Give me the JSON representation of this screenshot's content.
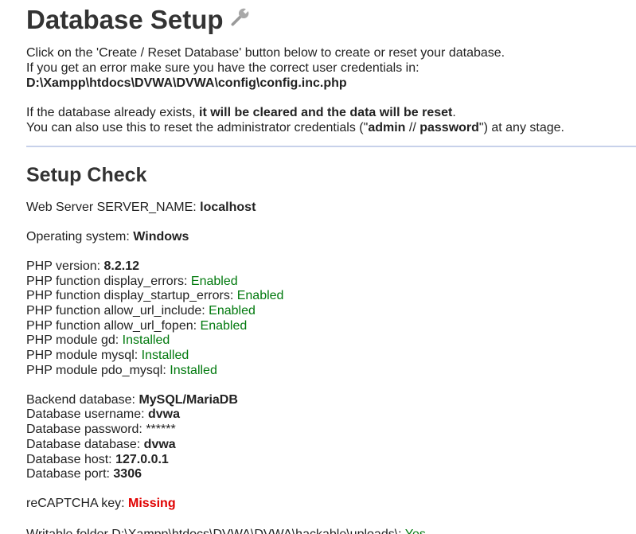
{
  "header": {
    "title": "Database Setup",
    "icon": "wrench-icon"
  },
  "intro": {
    "line1": "Click on the 'Create / Reset Database' button below to create or reset your database.",
    "line2": "If you get an error make sure you have the correct user credentials in:",
    "config_path": "D:\\Xampp\\htdocs\\DVWA\\DVWA\\config\\config.inc.php",
    "line3_prefix": "If the database already exists, ",
    "line3_bold": "it will be cleared and the data will be reset",
    "line3_suffix": ".",
    "line4_prefix": "You can also use this to reset the administrator credentials (\"",
    "line4_user": "admin",
    "line4_sep": " // ",
    "line4_pass": "password",
    "line4_suffix": "\") at any stage."
  },
  "setup_check": {
    "title": "Setup Check",
    "server_name_label": "Web Server SERVER_NAME: ",
    "server_name_value": "localhost",
    "os_label": "Operating system: ",
    "os_value": "Windows",
    "php_version_label": "PHP version: ",
    "php_version_value": "8.2.12",
    "php_checks": [
      {
        "label": "PHP function display_errors: ",
        "value": "Enabled"
      },
      {
        "label": "PHP function display_startup_errors: ",
        "value": "Enabled"
      },
      {
        "label": "PHP function allow_url_include: ",
        "value": "Enabled"
      },
      {
        "label": "PHP function allow_url_fopen: ",
        "value": "Enabled"
      },
      {
        "label": "PHP module gd: ",
        "value": "Installed"
      },
      {
        "label": "PHP module mysql: ",
        "value": "Installed"
      },
      {
        "label": "PHP module pdo_mysql: ",
        "value": "Installed"
      }
    ],
    "db": [
      {
        "label": "Backend database: ",
        "value": "MySQL/MariaDB",
        "bold": true
      },
      {
        "label": "Database username: ",
        "value": "dvwa",
        "bold": true
      },
      {
        "label": "Database password: ",
        "value": "******",
        "bold": false
      },
      {
        "label": "Database database: ",
        "value": "dvwa",
        "bold": true
      },
      {
        "label": "Database host: ",
        "value": "127.0.0.1",
        "bold": true
      },
      {
        "label": "Database port: ",
        "value": "3306",
        "bold": true
      }
    ],
    "recaptcha_label": "reCAPTCHA key: ",
    "recaptcha_value": "Missing",
    "writable_label": "Writable folder D:\\Xampp\\htdocs\\DVWA\\DVWA\\hackable\\uploads\\: ",
    "writable_value": "Yes"
  },
  "colors": {
    "ok": "#00790d",
    "bad": "#e00000",
    "divider": "#c7d1ea"
  }
}
